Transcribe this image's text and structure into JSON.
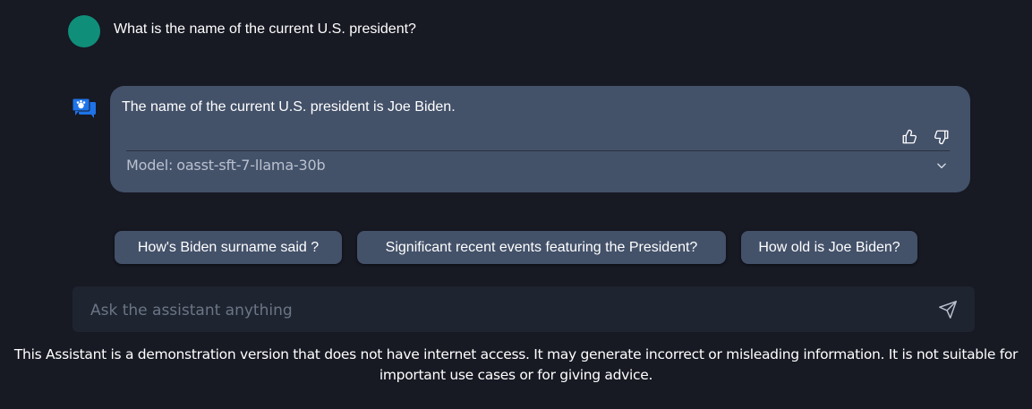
{
  "user_message": {
    "text": "What is the name of the current U.S. president?",
    "avatar_color": "#0f8f7a"
  },
  "assistant_message": {
    "text": "The name of the current U.S. president is Joe Biden.",
    "model_label": "Model:",
    "model_name": "oasst-sft-7-llama-30b",
    "icons": [
      "thumbs-up-icon",
      "thumbs-down-icon",
      "chevron-down-icon"
    ],
    "bubble_color": "#435169"
  },
  "suggestions": [
    "How's Biden surname said ?",
    "Significant recent events featuring the President?",
    "How old is Joe Biden?"
  ],
  "input": {
    "placeholder": "Ask the assistant anything",
    "value": "",
    "send_icon": "send-icon"
  },
  "disclaimer": {
    "line1": "This Assistant is a demonstration version that does not have internet access. It may generate incorrect or misleading information. It is not suitable for",
    "line2": "important use cases or for giving advice."
  },
  "colors": {
    "background": "#171923",
    "bot_icon_blue": "#1e73e8"
  }
}
